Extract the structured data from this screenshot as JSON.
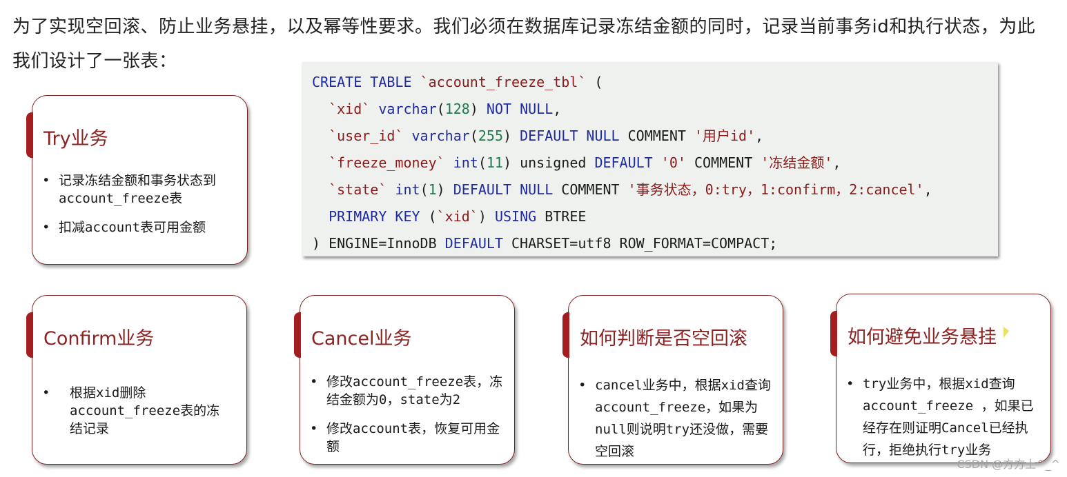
{
  "intro": "为了实现空回滚、防止业务悬挂，以及幂等性要求。我们必须在数据库记录冻结金额的同时，记录当前事务id和执行状态，为此我们设计了一张表：",
  "code": {
    "lines": [
      [
        {
          "t": "kw",
          "v": "CREATE TABLE "
        },
        {
          "t": "id",
          "v": "`account_freeze_tbl`"
        },
        {
          "t": "",
          "v": " ("
        }
      ],
      [
        {
          "t": "",
          "v": "  "
        },
        {
          "t": "id",
          "v": "`xid`"
        },
        {
          "t": "",
          "v": " "
        },
        {
          "t": "kw",
          "v": "varchar"
        },
        {
          "t": "",
          "v": "("
        },
        {
          "t": "num",
          "v": "128"
        },
        {
          "t": "",
          "v": ") "
        },
        {
          "t": "kw",
          "v": "NOT NULL"
        },
        {
          "t": "",
          "v": ","
        }
      ],
      [
        {
          "t": "",
          "v": "  "
        },
        {
          "t": "id",
          "v": "`user_id`"
        },
        {
          "t": "",
          "v": " "
        },
        {
          "t": "kw",
          "v": "varchar"
        },
        {
          "t": "",
          "v": "("
        },
        {
          "t": "num",
          "v": "255"
        },
        {
          "t": "",
          "v": ") "
        },
        {
          "t": "kw",
          "v": "DEFAULT NULL"
        },
        {
          "t": "",
          "v": " COMMENT "
        },
        {
          "t": "str",
          "v": "'用户id'"
        },
        {
          "t": "",
          "v": ","
        }
      ],
      [
        {
          "t": "",
          "v": "  "
        },
        {
          "t": "id",
          "v": "`freeze_money`"
        },
        {
          "t": "",
          "v": " "
        },
        {
          "t": "kw",
          "v": "int"
        },
        {
          "t": "",
          "v": "("
        },
        {
          "t": "num",
          "v": "11"
        },
        {
          "t": "",
          "v": ") unsigned "
        },
        {
          "t": "kw",
          "v": "DEFAULT"
        },
        {
          "t": "",
          "v": " "
        },
        {
          "t": "str",
          "v": "'0'"
        },
        {
          "t": "",
          "v": " COMMENT "
        },
        {
          "t": "str",
          "v": "'冻结金额'"
        },
        {
          "t": "",
          "v": ","
        }
      ],
      [
        {
          "t": "",
          "v": "  "
        },
        {
          "t": "id",
          "v": "`state`"
        },
        {
          "t": "",
          "v": " "
        },
        {
          "t": "kw",
          "v": "int"
        },
        {
          "t": "",
          "v": "("
        },
        {
          "t": "num",
          "v": "1"
        },
        {
          "t": "",
          "v": ") "
        },
        {
          "t": "kw",
          "v": "DEFAULT NULL"
        },
        {
          "t": "",
          "v": " COMMENT "
        },
        {
          "t": "str",
          "v": "'事务状态，0:try，1:confirm，2:cancel'"
        },
        {
          "t": "",
          "v": ","
        }
      ],
      [
        {
          "t": "",
          "v": "  "
        },
        {
          "t": "kw",
          "v": "PRIMARY KEY"
        },
        {
          "t": "",
          "v": " ("
        },
        {
          "t": "id",
          "v": "`xid`"
        },
        {
          "t": "",
          "v": ") "
        },
        {
          "t": "kw",
          "v": "USING"
        },
        {
          "t": "",
          "v": " BTREE"
        }
      ],
      [
        {
          "t": "",
          "v": ") ENGINE=InnoDB "
        },
        {
          "t": "kw",
          "v": "DEFAULT"
        },
        {
          "t": "",
          "v": " CHARSET=utf8 ROW_FORMAT=COMPACT;"
        }
      ]
    ]
  },
  "cards": [
    {
      "title": "Try业务",
      "items": [
        "记录冻结金额和事务状态到account_freeze表",
        "扣减account表可用金额"
      ]
    },
    {
      "title": "Confirm业务",
      "items": [
        "根据xid删除account_freeze表的冻结记录"
      ]
    },
    {
      "title": "Cancel业务",
      "items": [
        "修改account_freeze表，冻结金额为0，state为2",
        "修改account表，恢复可用金额"
      ]
    },
    {
      "title": "如何判断是否空回滚",
      "items": [
        "cancel业务中，根据xid查询account_freeze，如果为null则说明try还没做，需要空回滚"
      ]
    },
    {
      "title": "如何避免业务悬挂",
      "items": [
        "try业务中，根据xid查询account_freeze ，如果已经存在则证明Cancel已经执行，拒绝执行try业务"
      ]
    }
  ],
  "bullet": "•",
  "watermark": "CSDN @方方土^_^",
  "colors": {
    "accent": "#a31f1f",
    "title": "#8b2323",
    "keyword": "#1f2aa0",
    "identifier": "#8b1a1a",
    "number": "#1e7a4e"
  }
}
